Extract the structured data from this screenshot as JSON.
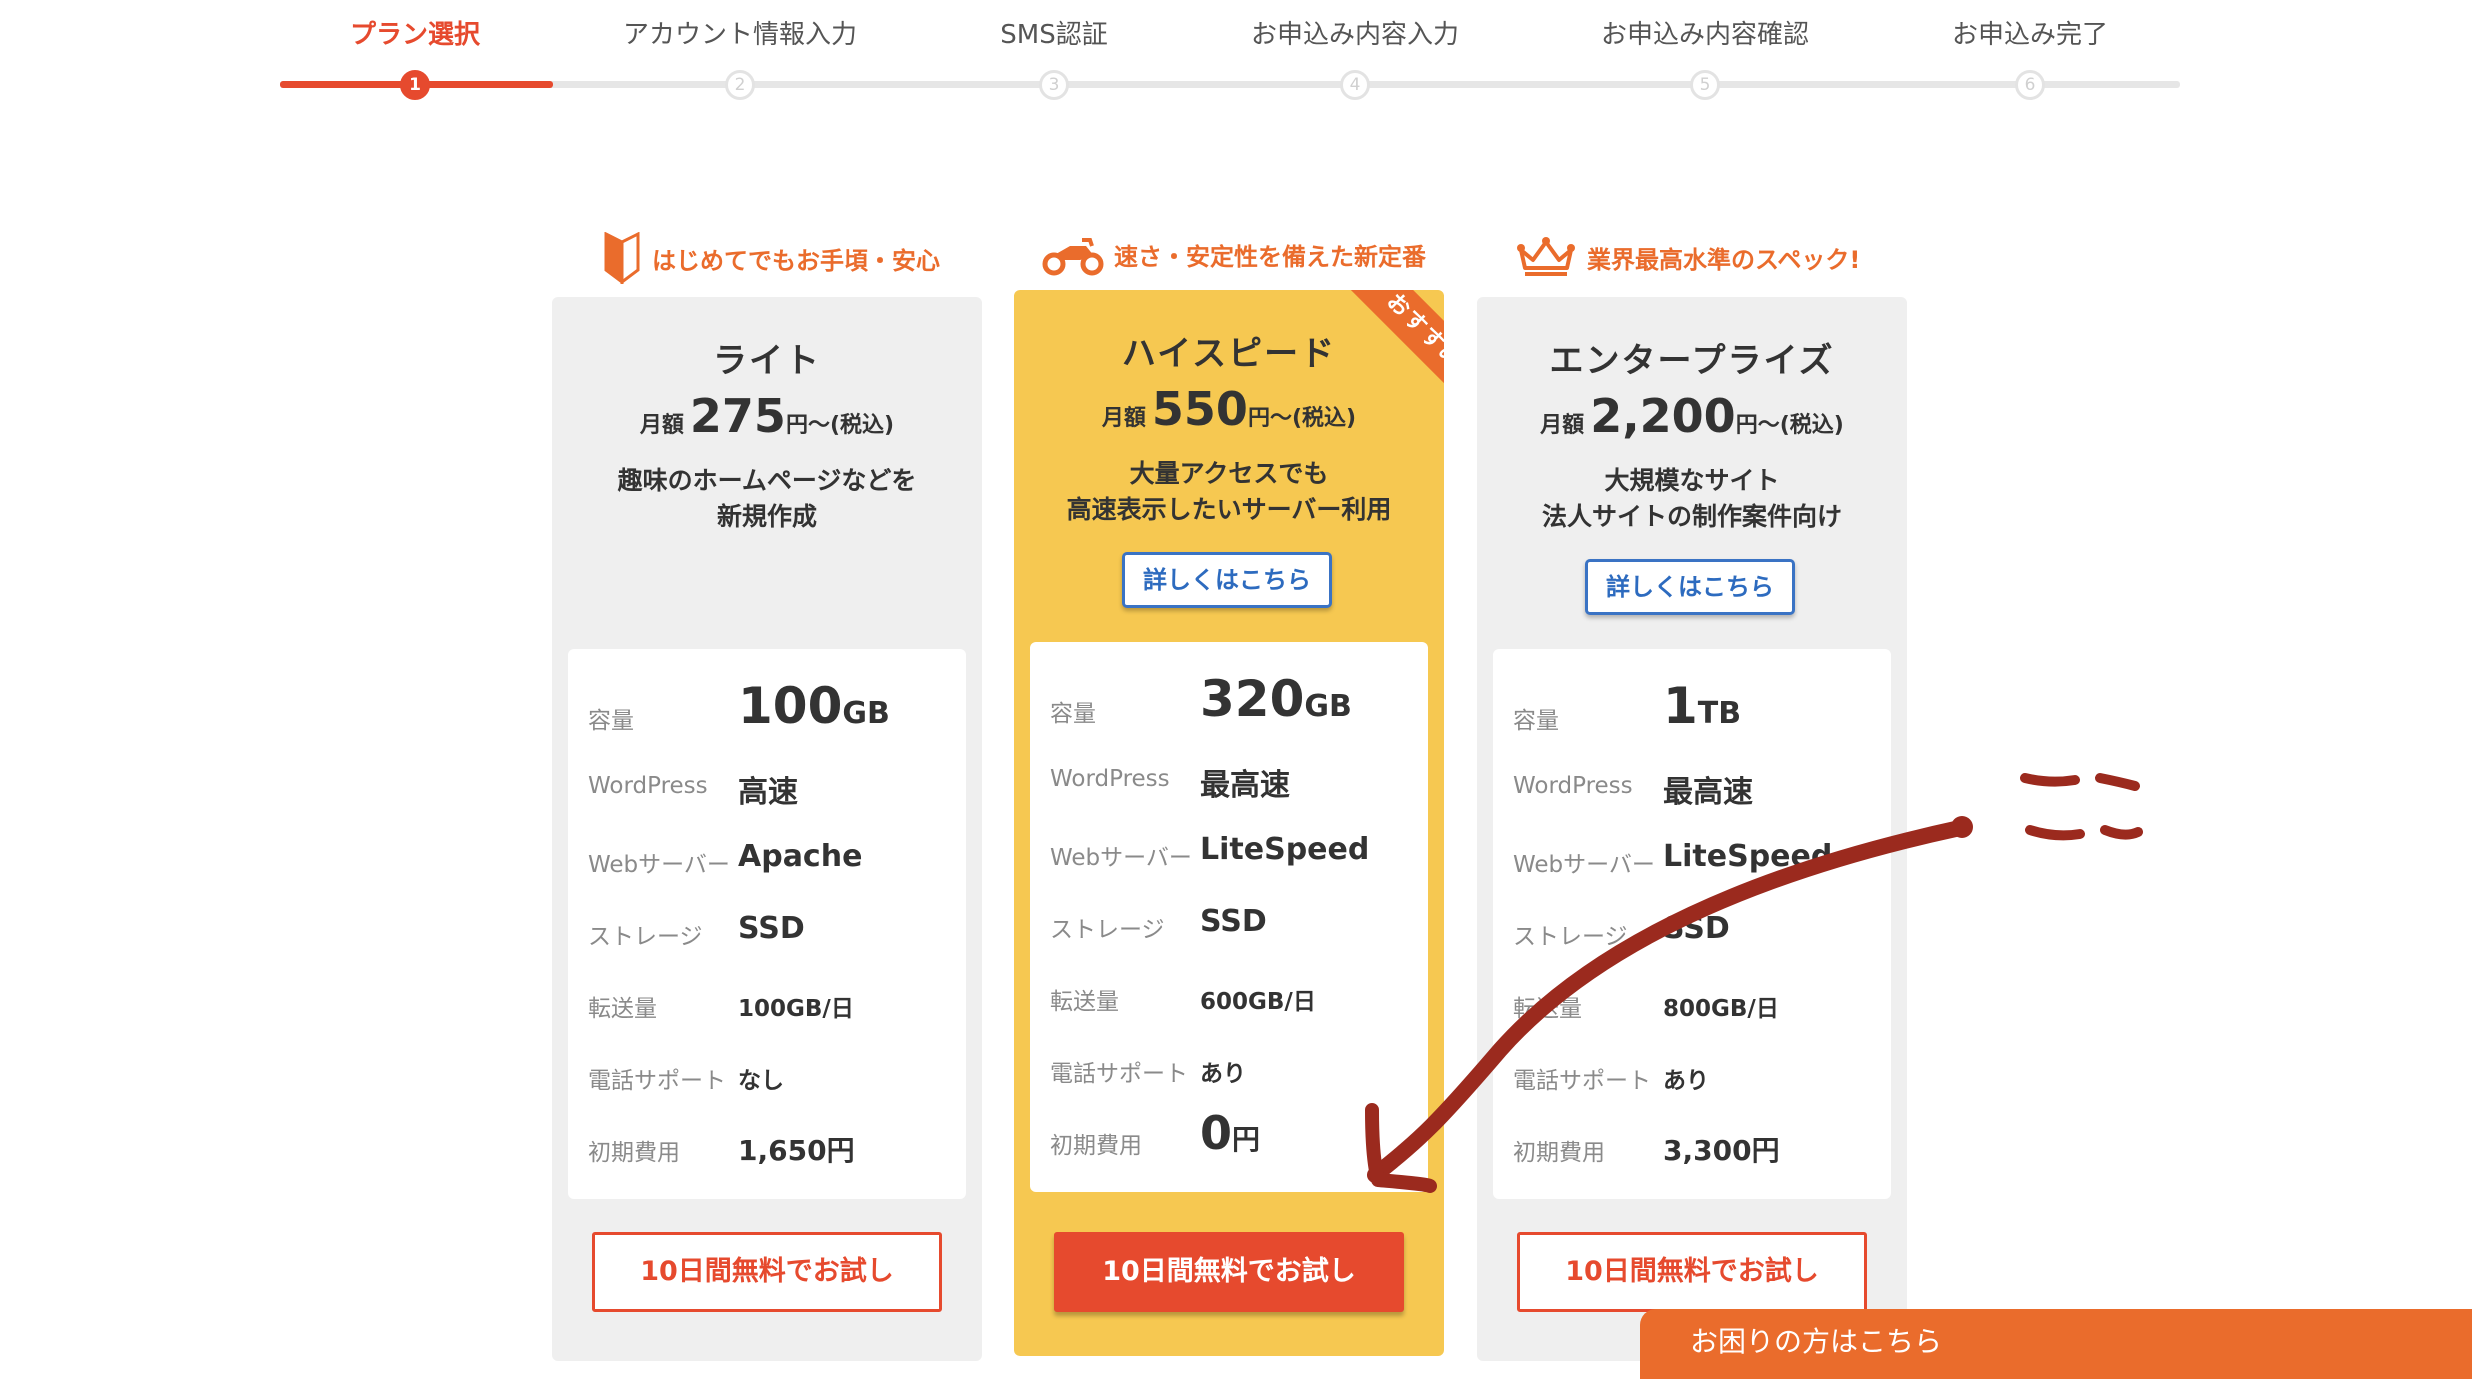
{
  "steps": [
    {
      "label": "プラン選択",
      "num": "1"
    },
    {
      "label": "アカウント情報入力",
      "num": "2"
    },
    {
      "label": "SMS認証",
      "num": "3"
    },
    {
      "label": "お申込み内容入力",
      "num": "4"
    },
    {
      "label": "お申込み内容確認",
      "num": "5"
    },
    {
      "label": "お申込み完了",
      "num": "6"
    }
  ],
  "current_step": 1,
  "spec_labels": {
    "capacity": "容量",
    "wordpress": "WordPress",
    "webserver": "Webサーバー",
    "storage": "ストレージ",
    "transfer": "転送量",
    "phone": "電話サポート",
    "initial": "初期費用"
  },
  "plans": [
    {
      "tagline": "はじめてでもお手頃・安心",
      "icon": "beginner-mark-icon",
      "name": "ライト",
      "price_prefix": "月額",
      "price": "275",
      "price_suffix": "円～(税込)",
      "description": "趣味のホームページなどを\n新規作成",
      "detail_label": "",
      "capacity_num": "100",
      "capacity_unit": "GB",
      "wordpress": "高速",
      "webserver": "Apache",
      "storage": "SSD",
      "transfer": "100GB/日",
      "phone": "なし",
      "initial": "1,650円",
      "trial_label": "10日間無料でお試し"
    },
    {
      "tagline": "速さ・安定性を備えた新定番",
      "icon": "motorcycle-icon",
      "name": "ハイスピード",
      "price_prefix": "月額",
      "price": "550",
      "price_suffix": "円～(税込)",
      "description": "大量アクセスでも\n高速表示したいサーバー利用",
      "detail_label": "詳しくはこちら",
      "ribbon": "おすすめ",
      "capacity_num": "320",
      "capacity_unit": "GB",
      "wordpress": "最高速",
      "webserver": "LiteSpeed",
      "storage": "SSD",
      "transfer": "600GB/日",
      "phone": "あり",
      "initial_num": "0",
      "initial_unit": "円",
      "trial_label": "10日間無料でお試し"
    },
    {
      "tagline": "業界最高水準のスペック!",
      "icon": "crown-icon",
      "name": "エンタープライズ",
      "price_prefix": "月額",
      "price": "2,200",
      "price_suffix": "円～(税込)",
      "description": "大規模なサイト\n法人サイトの制作案件向け",
      "detail_label": "詳しくはこちら",
      "capacity_num": "1",
      "capacity_unit": "TB",
      "wordpress": "最高速",
      "webserver": "LiteSpeed",
      "storage": "SSD",
      "transfer": "800GB/日",
      "phone": "あり",
      "initial": "3,300円",
      "trial_label": "10日間無料でお試し"
    }
  ],
  "help_label": "お困りの方はこちら",
  "annotation": {
    "text": "ここ",
    "color": "#9b2a1e"
  },
  "colors": {
    "accent": "#e64a2e",
    "orange": "#ea6c2c",
    "featured": "#f6c851",
    "link": "#2d6bbf",
    "card": "#efefef"
  }
}
